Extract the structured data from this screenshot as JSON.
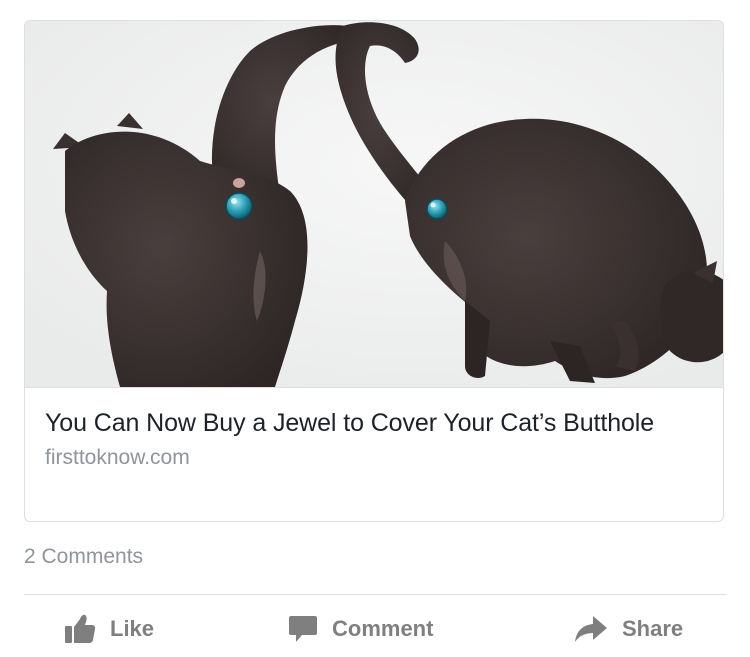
{
  "post": {
    "link_card": {
      "image_alt": "Two dark grey cats from behind with raised tails, each wearing a sparkling blue jewel",
      "title": "You Can Now Buy a Jewel to Cover Your Cat’s Butthole",
      "domain": "firsttoknow.com"
    },
    "comments_count": "2 Comments",
    "actions": {
      "like_label": "Like",
      "comment_label": "Comment",
      "share_label": "Share"
    }
  },
  "colors": {
    "text_primary": "#1d2129",
    "text_secondary": "#90949c",
    "action_grey": "#7f7f7f",
    "border": "#dddfe2",
    "jewel": "#2e9fb5"
  },
  "icons": {
    "like": "thumbs-up-icon",
    "comment": "speech-bubble-icon",
    "share": "share-arrow-icon"
  }
}
